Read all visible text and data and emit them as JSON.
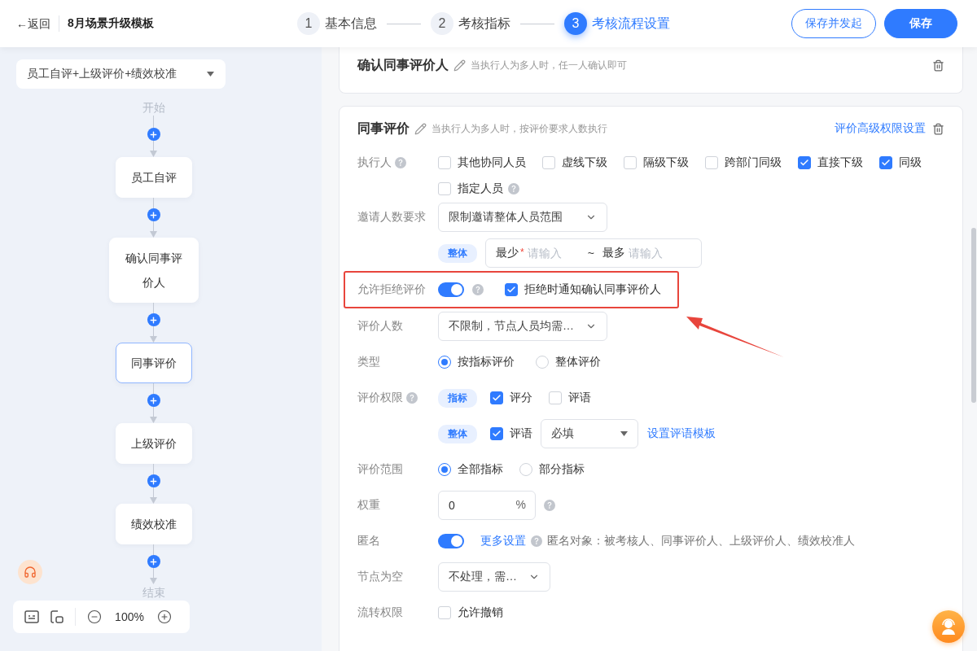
{
  "header": {
    "back": "←返回",
    "title": "8月场景升级模板",
    "steps": [
      {
        "number": "1",
        "label": "基本信息",
        "selected": false
      },
      {
        "number": "2",
        "label": "考核指标",
        "selected": false
      },
      {
        "number": "3",
        "label": "考核流程设置",
        "selected": true
      }
    ],
    "buttons": [
      {
        "label": "保存并发起",
        "kind": "outline"
      },
      {
        "label": "保存",
        "kind": "primary"
      }
    ]
  },
  "flow": {
    "template": "员工自评+上级评价+绩效校准",
    "start": "开始",
    "nodes": [
      {
        "label": "员工自评",
        "selected": false
      },
      {
        "label": "确认同事评价人",
        "selected": false
      },
      {
        "label": "同事评价",
        "selected": true
      },
      {
        "label": "上级评价",
        "selected": false
      },
      {
        "label": "绩效校准",
        "selected": false
      }
    ],
    "end": "结束",
    "zoom": "100%"
  },
  "confirm_card": {
    "title": "确认同事评价人",
    "hint": "当执行人为多人时，任一人确认即可"
  },
  "peer_card": {
    "title": "同事评价",
    "hint": "当执行人为多人时，按评价要求人数执行",
    "link": "评价高级权限设置",
    "executors": {
      "label": "执行人",
      "options": [
        {
          "label": "其他协同人员",
          "checked": false
        },
        {
          "label": "虚线下级",
          "checked": false
        },
        {
          "label": "隔级下级",
          "checked": false
        },
        {
          "label": "跨部门同级",
          "checked": false
        },
        {
          "label": "直接下级",
          "checked": true
        },
        {
          "label": "同级",
          "checked": true
        },
        {
          "label": "指定人员",
          "checked": false
        }
      ]
    },
    "invite": {
      "label": "邀请人数要求",
      "value": "限制邀请整体人员范围",
      "tag": "整体",
      "min_label": "最少",
      "required_mark": "*",
      "min_placeholder": "请输入",
      "separator": "~",
      "max_label": "最多",
      "max_placeholder": "请输入"
    },
    "refuse": {
      "label": "允许拒绝评价",
      "on": true,
      "highlighted": true,
      "notify": {
        "label": "拒绝时通知确认同事评价人",
        "checked": true
      }
    },
    "count": {
      "label": "评价人数",
      "value": "不限制，节点人员均需…"
    },
    "type": {
      "label": "类型",
      "options": [
        {
          "label": "按指标评价",
          "selected": true
        },
        {
          "label": "整体评价",
          "selected": false
        }
      ]
    },
    "permission": {
      "label": "评价权限",
      "groups": [
        {
          "tag": "指标",
          "options": [
            {
              "label": "评分",
              "checked": true
            },
            {
              "label": "评语",
              "checked": false
            }
          ]
        },
        {
          "tag": "整体",
          "options": [
            {
              "label": "评语",
              "checked": true
            }
          ],
          "select": "必填",
          "link": "设置评语模板"
        }
      ]
    },
    "scope": {
      "label": "评价范围",
      "options": [
        {
          "label": "全部指标",
          "selected": true
        },
        {
          "label": "部分指标",
          "selected": false
        }
      ]
    },
    "weight": {
      "label": "权重",
      "value": "0",
      "unit": "%"
    },
    "anonymous": {
      "label": "匿名",
      "on": true,
      "link": "更多设置",
      "note": "匿名对象：被考核人、同事评价人、上级评价人、绩效校准人"
    },
    "empty": {
      "label": "节点为空",
      "value": "不处理，需…"
    },
    "transfer": {
      "label": "流转权限",
      "options": [
        {
          "label": "允许撤销",
          "checked": false
        }
      ]
    }
  }
}
